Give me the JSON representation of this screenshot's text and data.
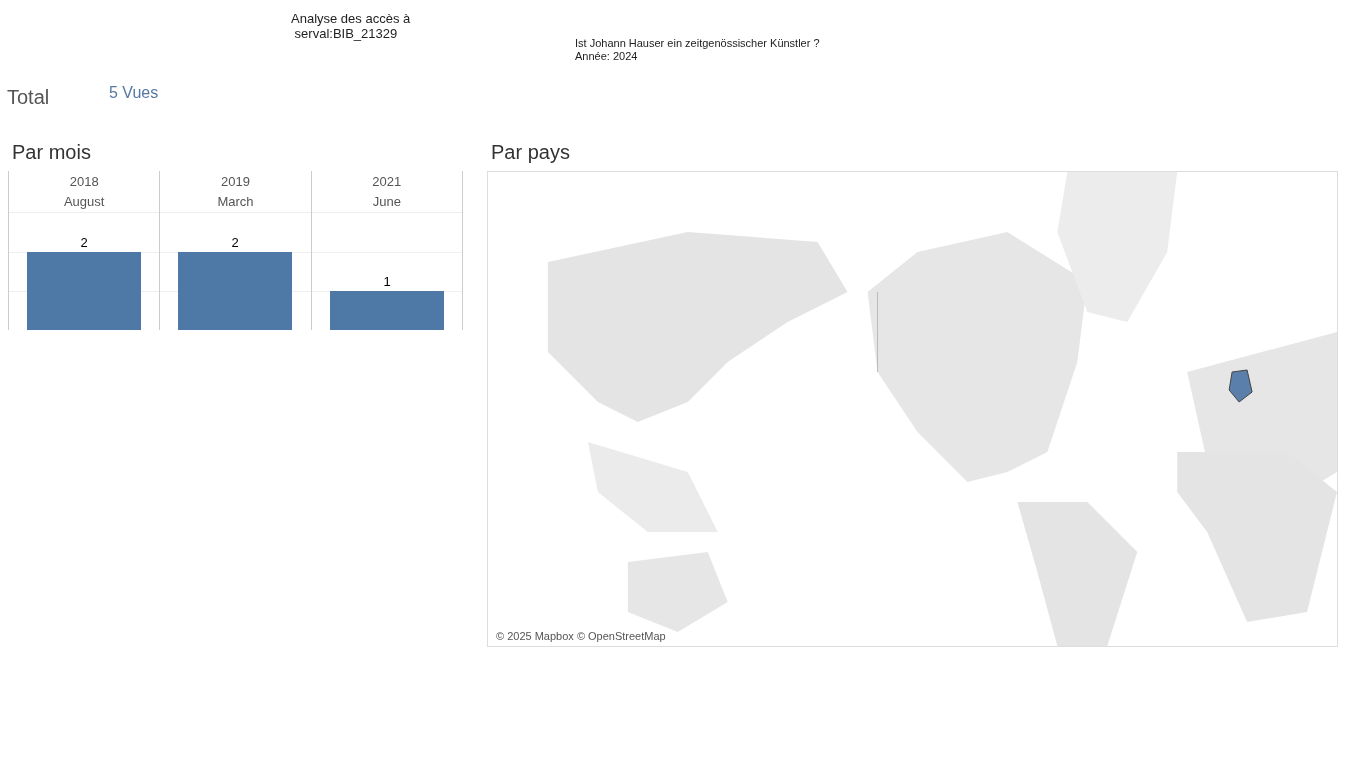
{
  "header": {
    "title_lines": [
      "Analyse des accès à",
      " serval:BIB_21329"
    ],
    "subtitle_lines": [
      "Ist Johann Hauser ein zeitgenössischer Künstler ?",
      "Année: 2024"
    ]
  },
  "total": {
    "label": "Total",
    "value": "5 Vues"
  },
  "by_month": {
    "title": "Par mois",
    "years": [
      "2018",
      "2019",
      "2021"
    ],
    "chart_data": {
      "type": "bar",
      "categories": [
        "August",
        "March",
        "June"
      ],
      "values": [
        2,
        2,
        1
      ],
      "grid": true,
      "data_labels": true
    }
  },
  "by_country": {
    "title": "Par pays",
    "attribution": "© 2025 Mapbox © OpenStreetMap"
  }
}
